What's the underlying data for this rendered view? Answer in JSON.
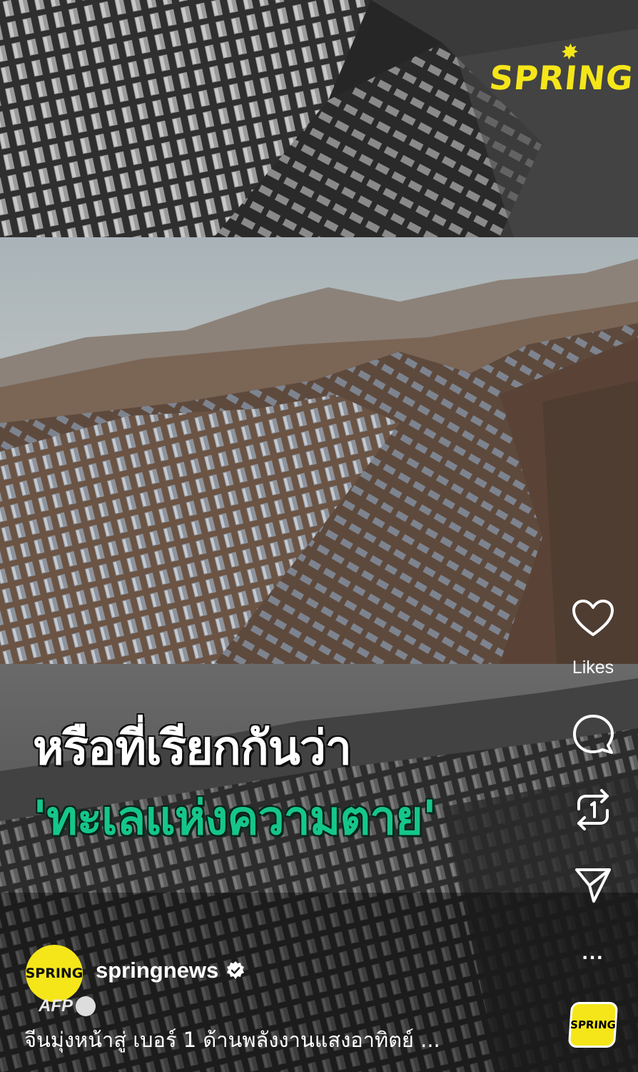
{
  "brand": {
    "logo_text": "SPRING",
    "color_yellow": "#f5e61a"
  },
  "overlay": {
    "headline_line1": "หรือที่เรียกกันว่า",
    "headline_line2": "'ทะเลแห่งความตาย'",
    "headline_line2_color": "#15c68a"
  },
  "actions": {
    "likes_label": "Likes",
    "more": "...",
    "icons": [
      "heart-icon",
      "comment-icon",
      "repost-icon",
      "share-icon",
      "more-icon"
    ]
  },
  "account": {
    "avatar_text": "SPRING",
    "username": "springnews",
    "verified": true
  },
  "watermark": "AFP",
  "caption": "จีนมุ่งหน้าสู่ เบอร์ 1 ด้านพลังงานแสงอาทิตย์ ...",
  "audio": {
    "thumb_text": "SPRING"
  }
}
